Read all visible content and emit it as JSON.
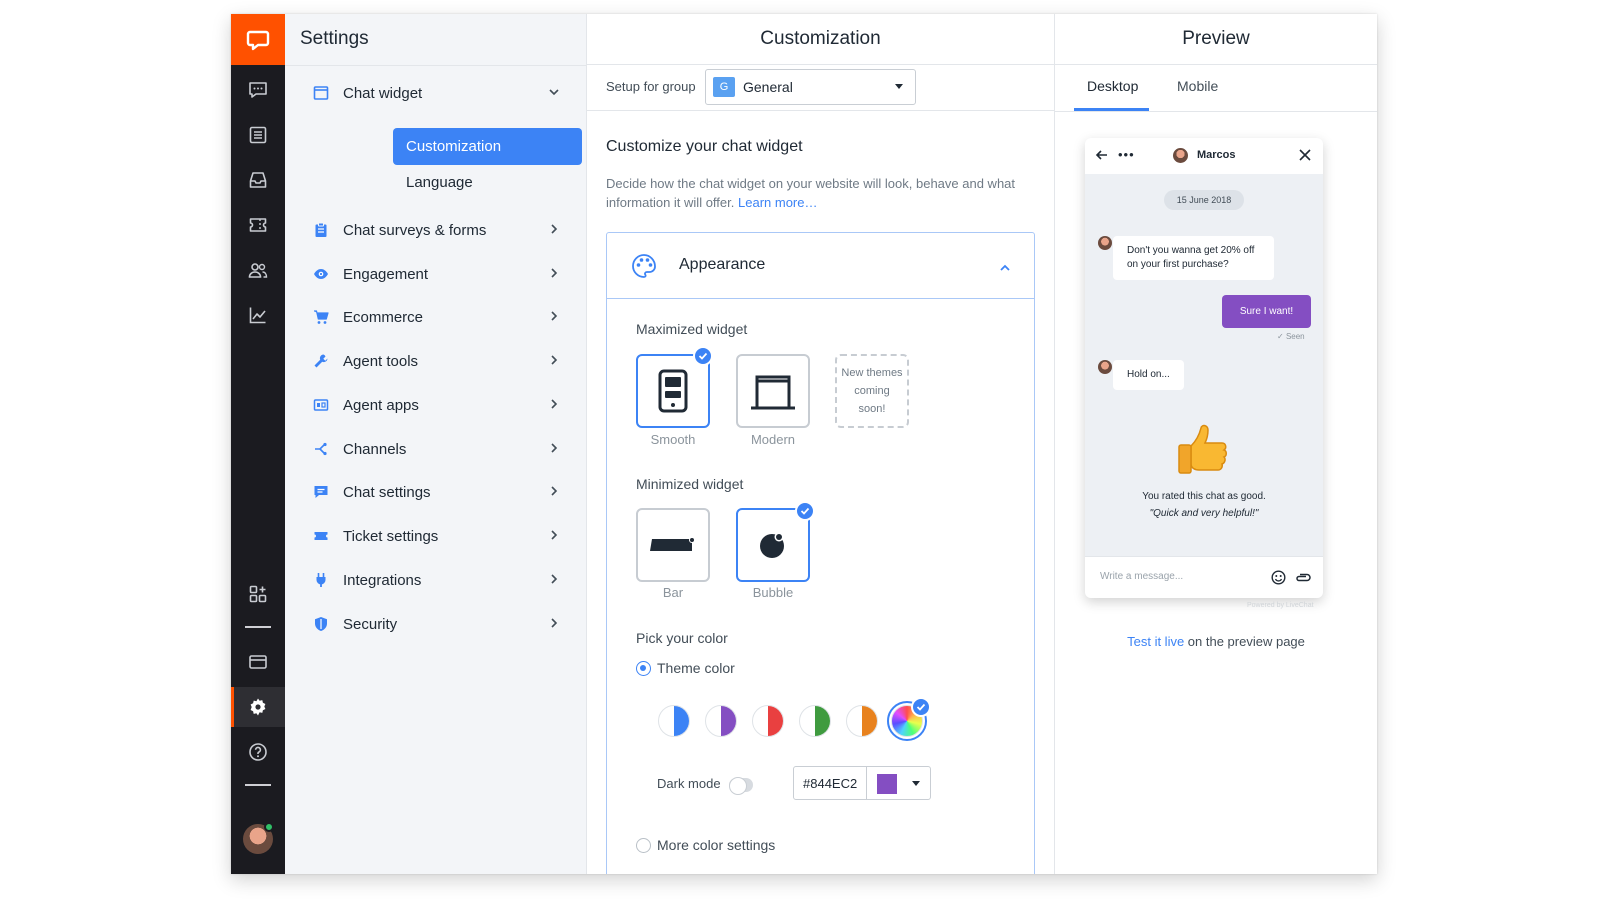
{
  "colors": {
    "brand": "#ff5100",
    "accent": "#3c83f5",
    "theme_color": "#844EC2"
  },
  "rail": {
    "icons": [
      "chats-icon",
      "archives-icon",
      "inbox-icon",
      "tickets-icon",
      "customers-icon",
      "reports-icon",
      "apps-icon",
      "billing-icon",
      "settings-icon",
      "help-icon"
    ],
    "active": "settings-icon"
  },
  "nav": {
    "title": "Settings",
    "chat_widget": "Chat widget",
    "sub_items": [
      {
        "label": "Customization",
        "active": true
      },
      {
        "label": "Language",
        "active": false
      }
    ],
    "items": [
      {
        "label": "Chat surveys & forms",
        "icon": "clipboard-icon"
      },
      {
        "label": "Engagement",
        "icon": "eye-icon"
      },
      {
        "label": "Ecommerce",
        "icon": "cart-icon"
      },
      {
        "label": "Agent tools",
        "icon": "wrench-icon"
      },
      {
        "label": "Agent apps",
        "icon": "agent-apps-icon"
      },
      {
        "label": "Channels",
        "icon": "channels-icon"
      },
      {
        "label": "Chat settings",
        "icon": "chat-bubble-icon"
      },
      {
        "label": "Ticket settings",
        "icon": "ticket-icon"
      },
      {
        "label": "Integrations",
        "icon": "plug-icon"
      },
      {
        "label": "Security",
        "icon": "shield-icon"
      }
    ]
  },
  "customization": {
    "heading": "Customization",
    "group_label": "Setup for group",
    "group_badge": "G",
    "group_value": "General",
    "title": "Customize your chat widget",
    "description": "Decide how the chat widget on your website will look, behave and what information it will offer.",
    "learn_more": "Learn more…",
    "appearance": {
      "title": "Appearance",
      "maximized_label": "Maximized widget",
      "maximized_options": [
        {
          "label": "Smooth",
          "selected": true
        },
        {
          "label": "Modern",
          "selected": false
        }
      ],
      "new_themes": "New themes coming soon!",
      "minimized_label": "Minimized widget",
      "minimized_options": [
        {
          "label": "Bar",
          "selected": false
        },
        {
          "label": "Bubble",
          "selected": true
        }
      ],
      "color_label": "Pick your color",
      "theme_color_label": "Theme color",
      "swatches": [
        "#3c83f5",
        "#844ec2",
        "#e94040",
        "#3f9b3f",
        "#e8821e",
        "rainbow"
      ],
      "selected_swatch": "rainbow",
      "dark_mode_label": "Dark mode",
      "dark_mode": false,
      "hex_value": "#844EC2",
      "more_colors_label": "More color settings"
    }
  },
  "preview": {
    "heading": "Preview",
    "tabs": [
      {
        "label": "Desktop",
        "active": true
      },
      {
        "label": "Mobile",
        "active": false
      }
    ],
    "widget": {
      "agent_name": "Marcos",
      "date": "15 June 2018",
      "msg1": "Don't you wanna get 20% off on your first purchase?",
      "reply": "Sure I want!",
      "seen": "Seen",
      "msg2": "Hold on...",
      "rated": "You rated this chat as good.",
      "comment": "\"Quick and very helpful!\"",
      "input_placeholder": "Write a message...",
      "powered_by": "Powered by LiveChat"
    },
    "test_link": "Test it live",
    "test_rest": " on the preview page"
  }
}
